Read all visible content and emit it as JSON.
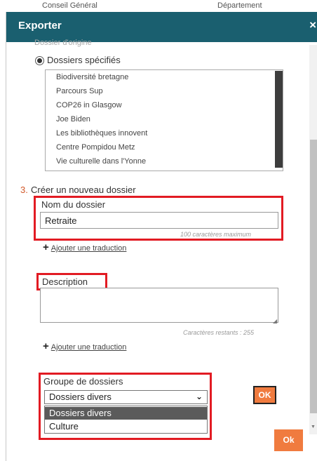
{
  "background": {
    "text_left": "Conseil Général",
    "text_right": "Département"
  },
  "modal": {
    "title": "Exporter",
    "close": "×"
  },
  "folders_section": {
    "cut_option": "Dossier d'origine",
    "radio_label": "Dossiers spécifiés",
    "items": [
      "Biodiversité bretagne",
      "Parcours Sup",
      "COP26 in Glasgow",
      "Joe Biden",
      "Les bibliothèques innovent",
      "Centre Pompidou Metz",
      "Vie culturelle dans l'Yonne"
    ]
  },
  "new_folder": {
    "step_number": "3.",
    "step_label": "Créer un nouveau dossier",
    "name_label": "Nom du dossier",
    "name_value": "Retraite",
    "name_hint": "100 caractères maximum",
    "add_translation": "Ajouter une traduction",
    "description_label": "Description",
    "description_value": "",
    "description_hint": "Caractères restants : 255",
    "group_label": "Groupe de dossiers",
    "group_selected": "Dossiers divers",
    "group_options": [
      "Dossiers divers",
      "Culture"
    ]
  },
  "buttons": {
    "ok_small": "OK",
    "ok_big": "Ok"
  },
  "colors": {
    "header": "#1a5f6f",
    "accent": "#f07b3f",
    "highlight": "#e21b23",
    "step_number": "#d2592a"
  },
  "icons": {
    "close": "close-icon",
    "plus": "plus-icon",
    "chevron": "chevron-down-icon",
    "radio": "radio-checked-icon"
  }
}
